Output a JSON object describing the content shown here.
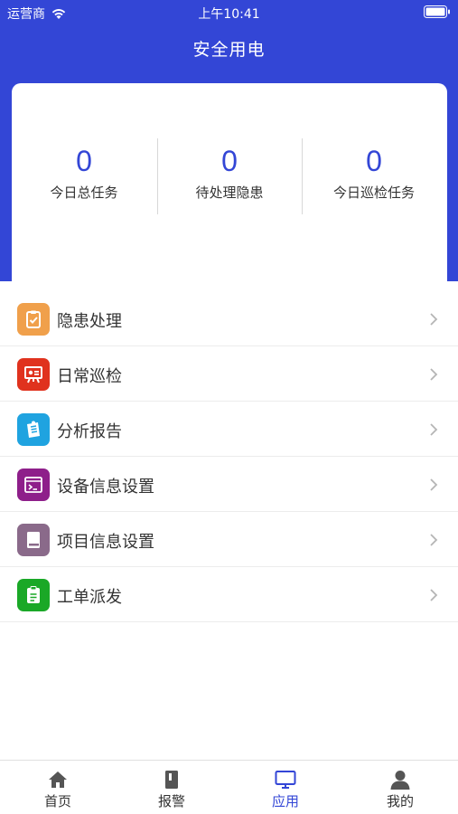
{
  "status_bar": {
    "carrier": "运营商",
    "time": "上午10:41"
  },
  "header": {
    "title": "安全用电"
  },
  "stats": [
    {
      "value": "0",
      "label": "今日总任务"
    },
    {
      "value": "0",
      "label": "待处理隐患"
    },
    {
      "value": "0",
      "label": "今日巡检任务"
    }
  ],
  "menu": {
    "items": [
      {
        "label": "隐患处理",
        "icon": "clipboard-check-icon",
        "color": "#f0a04b"
      },
      {
        "label": "日常巡检",
        "icon": "presentation-board-icon",
        "color": "#e0321e"
      },
      {
        "label": "分析报告",
        "icon": "report-icon",
        "color": "#1fa3e0"
      },
      {
        "label": "设备信息设置",
        "icon": "terminal-window-icon",
        "color": "#8e1f8a"
      },
      {
        "label": "项目信息设置",
        "icon": "book-icon",
        "color": "#8a6a8a"
      },
      {
        "label": "工单派发",
        "icon": "clipboard-list-icon",
        "color": "#1aa827"
      }
    ]
  },
  "tab_bar": {
    "tabs": [
      {
        "label": "首页",
        "icon": "home-icon"
      },
      {
        "label": "报警",
        "icon": "notebook-icon"
      },
      {
        "label": "应用",
        "icon": "monitor-icon",
        "active": true
      },
      {
        "label": "我的",
        "icon": "user-icon"
      }
    ],
    "active_color": "#3346d6"
  },
  "colors": {
    "primary": "#3346d6"
  }
}
